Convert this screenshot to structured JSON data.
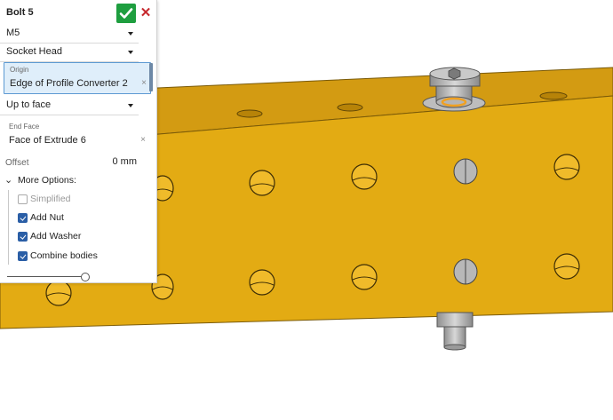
{
  "feature": {
    "title": "Bolt 5",
    "confirm_icon": "check-icon",
    "cancel_icon": "close-icon",
    "cancel_glyph": "✕",
    "size": "M5",
    "head_type": "Socket Head",
    "origin": {
      "label": "Origin",
      "value": "Edge of Profile Converter 2",
      "remove_glyph": "×"
    },
    "end_type": "Up to face",
    "end_face": {
      "label": "End Face",
      "value": "Face of Extrude 6",
      "remove_glyph": "×"
    },
    "offset": {
      "label": "Offset",
      "value": "0 mm"
    },
    "more_options": {
      "label": "More Options:",
      "chevron": "⌄"
    },
    "options": [
      {
        "label": "Simplified",
        "checked": false
      },
      {
        "label": "Add Nut",
        "checked": true
      },
      {
        "label": "Add Washer",
        "checked": true
      },
      {
        "label": "Combine bodies",
        "checked": true
      }
    ],
    "slider_level": 1.0
  },
  "colors": {
    "confirm": "#1e9e3f",
    "cancel": "#c6282d",
    "selection_bg": "#dfeefa",
    "selection_border": "#5d9ad3",
    "checkbox": "#2a5ea6",
    "beam_top": "#d29a10",
    "beam_front": "#e6ad14",
    "bolt_gray": "#a9a9a9",
    "washer_highlight": "#f0a020"
  }
}
